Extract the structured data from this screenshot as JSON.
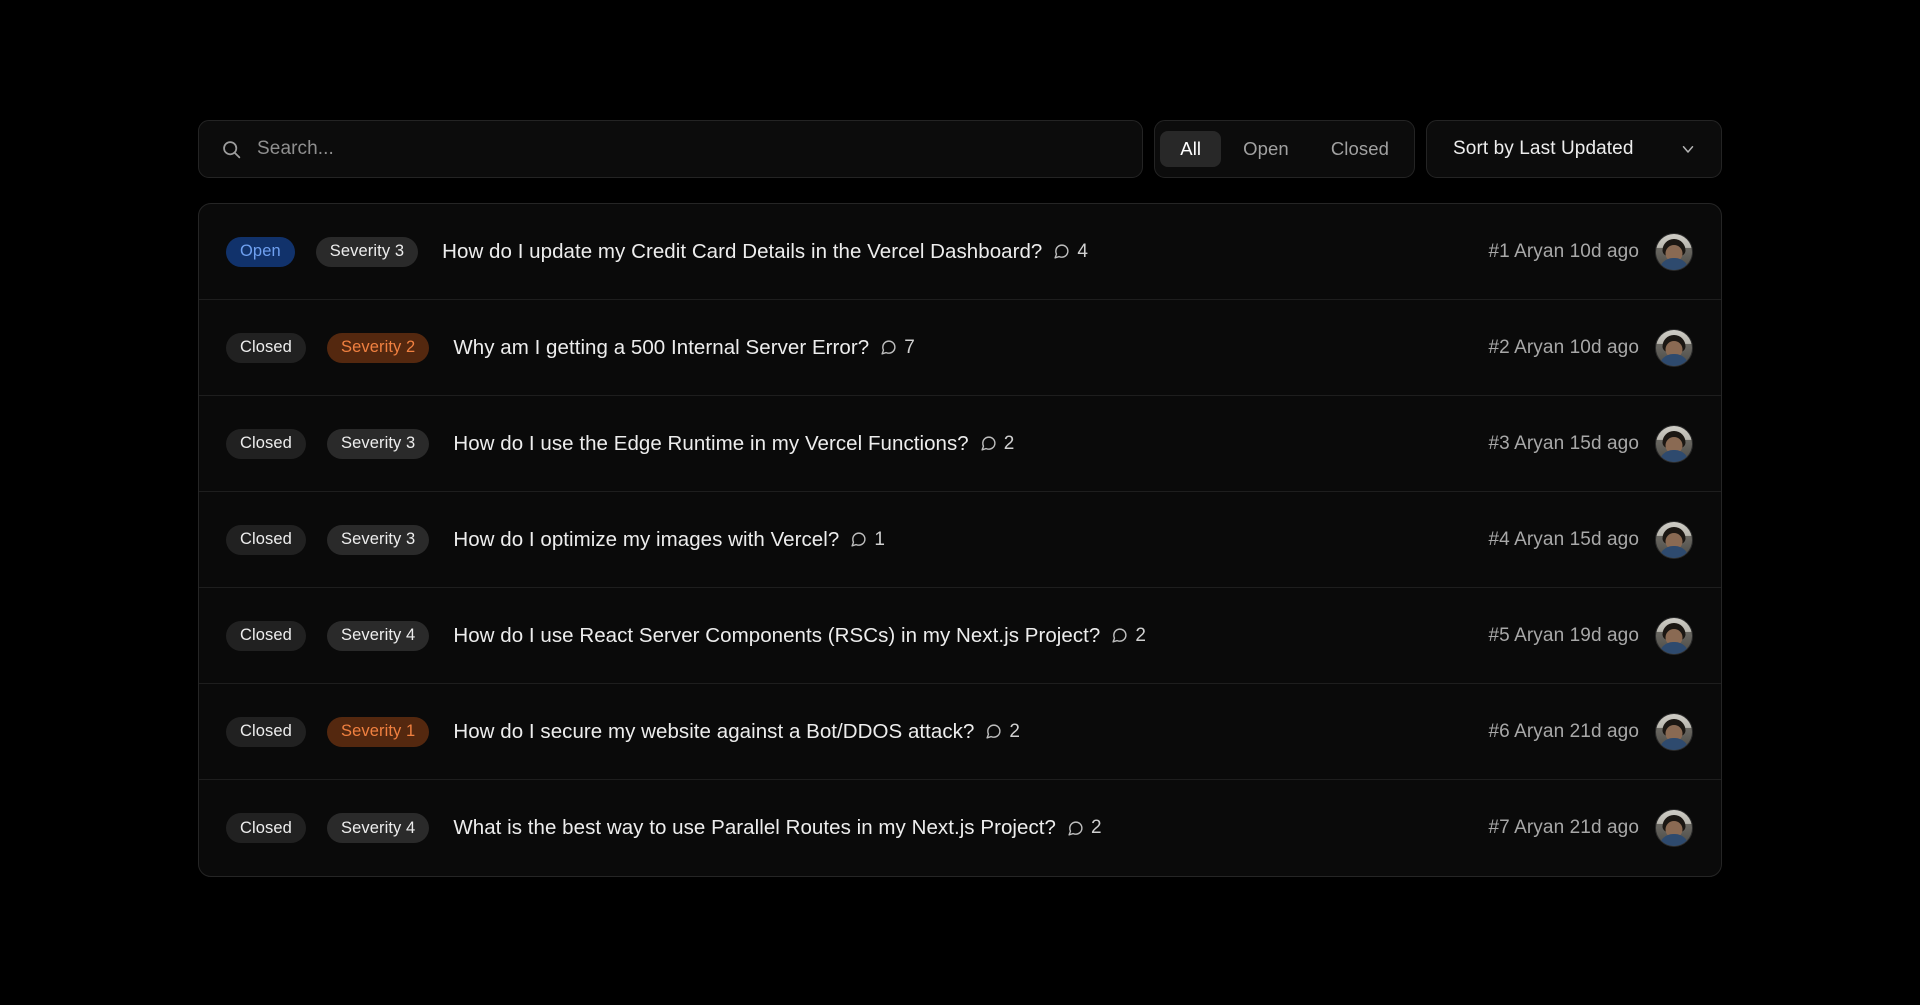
{
  "colors": {
    "page_background": "#000000",
    "panel_background": "#0a0a0a",
    "panel_border": "#252525",
    "accent_open": "#6fa0f0",
    "accent_open_bg": "#11326b",
    "accent_severity_high": "#f08040",
    "accent_severity_high_bg": "#54280f",
    "text_primary": "#ededed",
    "text_muted": "#a8a8a8"
  },
  "toolbar": {
    "search": {
      "placeholder": "Search...",
      "value": "",
      "icon": "search-icon"
    },
    "filters": {
      "selected": "All",
      "options": [
        "All",
        "Open",
        "Closed"
      ]
    },
    "sort": {
      "label": "Sort by Last Updated",
      "icon": "chevron-down-icon",
      "options": [
        "Sort by Last Updated"
      ]
    }
  },
  "issues": [
    {
      "status": "Open",
      "severity": "Severity 3",
      "severity_level": 3,
      "title": "How do I update my Credit Card Details in the Vercel Dashboard?",
      "comments": "4",
      "meta": "#1 Aryan 10d ago",
      "number": "#1",
      "author": "Aryan",
      "updated": "10d ago"
    },
    {
      "status": "Closed",
      "severity": "Severity 2",
      "severity_level": 2,
      "title": "Why am I getting a 500 Internal Server Error?",
      "comments": "7",
      "meta": "#2 Aryan 10d ago",
      "number": "#2",
      "author": "Aryan",
      "updated": "10d ago"
    },
    {
      "status": "Closed",
      "severity": "Severity 3",
      "severity_level": 3,
      "title": "How do I use the Edge Runtime in my Vercel Functions?",
      "comments": "2",
      "meta": "#3 Aryan 15d ago",
      "number": "#3",
      "author": "Aryan",
      "updated": "15d ago"
    },
    {
      "status": "Closed",
      "severity": "Severity 3",
      "severity_level": 3,
      "title": "How do I optimize my images with Vercel?",
      "comments": "1",
      "meta": "#4 Aryan 15d ago",
      "number": "#4",
      "author": "Aryan",
      "updated": "15d ago"
    },
    {
      "status": "Closed",
      "severity": "Severity 4",
      "severity_level": 4,
      "title": "How do I use React Server Components (RSCs) in my Next.js Project?",
      "comments": "2",
      "meta": "#5 Aryan 19d ago",
      "number": "#5",
      "author": "Aryan",
      "updated": "19d ago"
    },
    {
      "status": "Closed",
      "severity": "Severity 1",
      "severity_level": 1,
      "title": "How do I secure my website against a Bot/DDOS attack?",
      "comments": "2",
      "meta": "#6 Aryan 21d ago",
      "number": "#6",
      "author": "Aryan",
      "updated": "21d ago"
    },
    {
      "status": "Closed",
      "severity": "Severity 4",
      "severity_level": 4,
      "title": "What is the best way to use Parallel Routes in my Next.js Project?",
      "comments": "2",
      "meta": "#7 Aryan 21d ago",
      "number": "#7",
      "author": "Aryan",
      "updated": "21d ago"
    }
  ]
}
